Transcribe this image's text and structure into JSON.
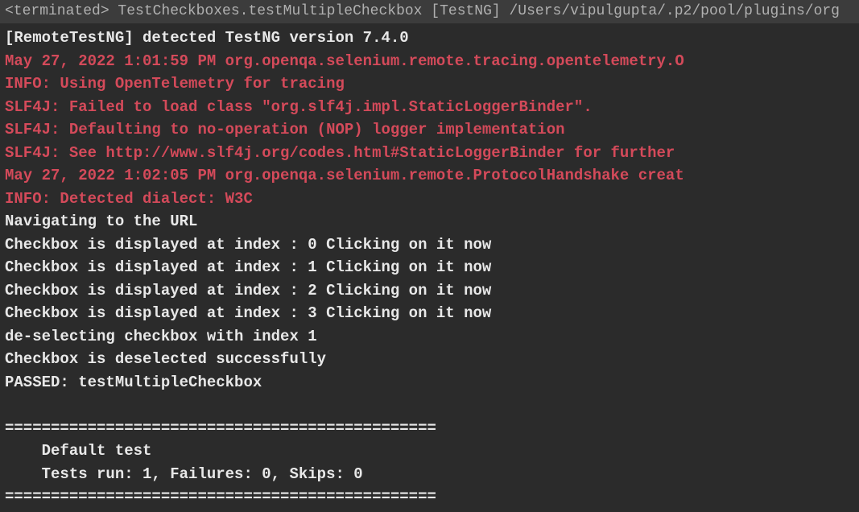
{
  "titleBar": "<terminated> TestCheckboxes.testMultipleCheckbox [TestNG] /Users/vipulgupta/.p2/pool/plugins/org",
  "lines": [
    {
      "style": "white",
      "text": "[RemoteTestNG] detected TestNG version 7.4.0"
    },
    {
      "style": "red",
      "text": "May 27, 2022 1:01:59 PM org.openqa.selenium.remote.tracing.opentelemetry.O"
    },
    {
      "style": "red",
      "text": "INFO: Using OpenTelemetry for tracing"
    },
    {
      "style": "red",
      "text": "SLF4J: Failed to load class \"org.slf4j.impl.StaticLoggerBinder\"."
    },
    {
      "style": "red",
      "text": "SLF4J: Defaulting to no-operation (NOP) logger implementation"
    },
    {
      "style": "red",
      "text": "SLF4J: See http://www.slf4j.org/codes.html#StaticLoggerBinder for further "
    },
    {
      "style": "red",
      "text": "May 27, 2022 1:02:05 PM org.openqa.selenium.remote.ProtocolHandshake creat"
    },
    {
      "style": "red",
      "text": "INFO: Detected dialect: W3C"
    },
    {
      "style": "white",
      "text": "Navigating to the URL"
    },
    {
      "style": "white",
      "text": "Checkbox is displayed at index : 0 Clicking on it now"
    },
    {
      "style": "white",
      "text": "Checkbox is displayed at index : 1 Clicking on it now"
    },
    {
      "style": "white",
      "text": "Checkbox is displayed at index : 2 Clicking on it now"
    },
    {
      "style": "white",
      "text": "Checkbox is displayed at index : 3 Clicking on it now"
    },
    {
      "style": "white",
      "text": "de-selecting checkbox with index 1"
    },
    {
      "style": "white",
      "text": "Checkbox is deselected successfully"
    },
    {
      "style": "white",
      "text": "PASSED: testMultipleCheckbox"
    },
    {
      "style": "white",
      "text": ""
    },
    {
      "style": "white",
      "text": "==============================================="
    },
    {
      "style": "white",
      "text": "    Default test"
    },
    {
      "style": "white",
      "text": "    Tests run: 1, Failures: 0, Skips: 0"
    },
    {
      "style": "white",
      "text": "==============================================="
    }
  ]
}
